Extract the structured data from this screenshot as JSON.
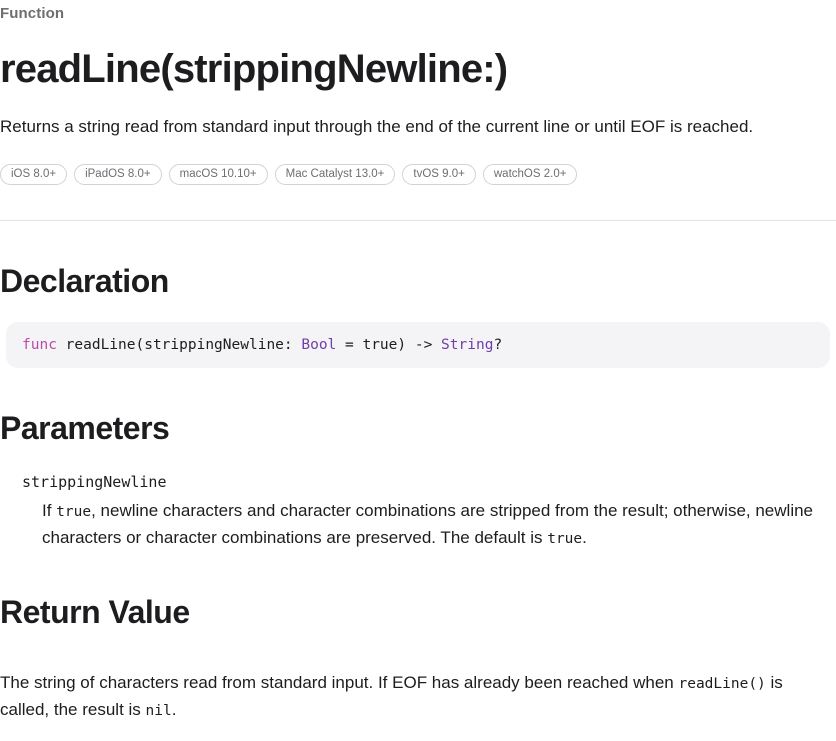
{
  "header": {
    "eyebrow": "Function",
    "title": "readLine(strippingNewline:)",
    "abstract": "Returns a string read from standard input through the end of the current line or until EOF is reached."
  },
  "availability": {
    "platforms": [
      {
        "label": "iOS 8.0+"
      },
      {
        "label": "iPadOS 8.0+"
      },
      {
        "label": "macOS 10.10+"
      },
      {
        "label": "Mac Catalyst 13.0+"
      },
      {
        "label": "tvOS 9.0+"
      },
      {
        "label": "watchOS 2.0+"
      }
    ]
  },
  "declaration": {
    "heading": "Declaration",
    "code": {
      "full": "func readLine(strippingNewline: Bool = true) -> String?",
      "tokens": {
        "keyword": "func",
        "space1": " ",
        "signature_start": "readLine(strippingNewline: ",
        "type_bool": "Bool",
        "middle": " = true) -> ",
        "type_string": "String",
        "optional": "?"
      }
    }
  },
  "parameters": {
    "heading": "Parameters",
    "items": [
      {
        "name": "strippingNewline",
        "desc_part1": "If ",
        "desc_code1": "true",
        "desc_part2": ", newline characters and character combinations are stripped from the result; otherwise, newline characters or character combinations are preserved. The default is ",
        "desc_code2": "true",
        "desc_part3": "."
      }
    ]
  },
  "return_value": {
    "heading": "Return Value",
    "desc_part1": "The string of characters read from standard input. If EOF has already been reached when ",
    "desc_code1": "readLine()",
    "desc_part2": " is called, the result is ",
    "desc_code2": "nil",
    "desc_part3": "."
  },
  "colors": {
    "text": "#1d1d1f",
    "muted": "#6e6e73",
    "divider": "#e3e3e5",
    "code_background": "#f4f4f6",
    "pill_border": "#d2d2d7",
    "syntax_keyword": "#ba4ba8",
    "syntax_type": "#703daa"
  }
}
